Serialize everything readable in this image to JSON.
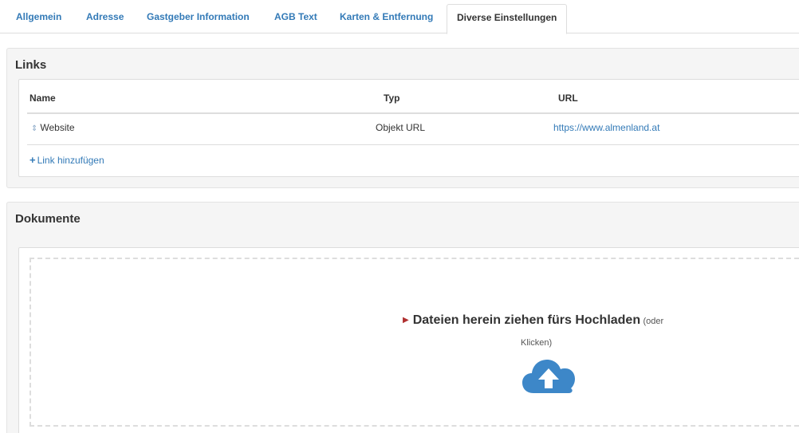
{
  "tabs": [
    {
      "label": "Allgemein"
    },
    {
      "label": "Adresse"
    },
    {
      "label": "Gastgeber Information"
    },
    {
      "label": "AGB Text"
    },
    {
      "label": "Karten & Entfernung"
    },
    {
      "label": "Diverse Einstellungen",
      "active": true
    }
  ],
  "links_panel": {
    "title": "Links",
    "columns": [
      "Name",
      "Typ",
      "URL"
    ],
    "rows": [
      {
        "name": "Website",
        "typ": "Objekt URL",
        "url": "https://www.almenland.at"
      }
    ],
    "add_label": "Link hinzufügen"
  },
  "documents_panel": {
    "title": "Dokumente",
    "dropzone_main": "Dateien herein ziehen fürs Hochladen",
    "dropzone_sub_1": "(oder",
    "dropzone_sub_2": "Klicken)",
    "upload_icon": "cloud-upload-icon"
  },
  "colors": {
    "link": "#337ab7",
    "panel_bg": "#f5f5f5",
    "border": "#dddddd",
    "caret": "#b03030",
    "cloud": "#3d87c8"
  }
}
